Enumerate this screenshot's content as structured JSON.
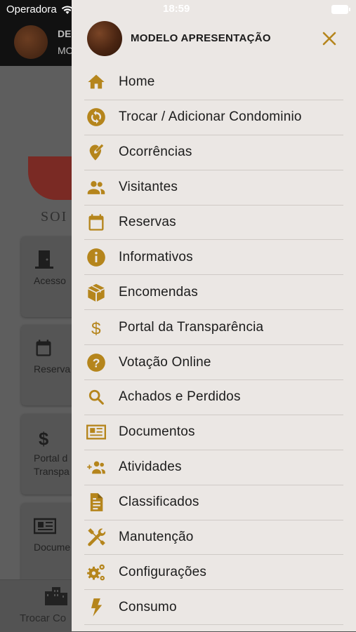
{
  "status_bar": {
    "carrier": "Operadora",
    "time": "18:59"
  },
  "background": {
    "header_line1": "DE",
    "header_line2": "MO",
    "logo_text": "SOI",
    "cards": [
      {
        "label": "Acesso",
        "icon": "door-icon"
      },
      {
        "label": "Reserva",
        "icon": "calendar-icon"
      },
      {
        "label": "Portal d\nTranspa",
        "icon": "dollar-icon"
      },
      {
        "label": "Docume",
        "icon": "newspaper-icon"
      }
    ],
    "tab_label": "Trocar Co"
  },
  "drawer": {
    "title": "MODELO APRESENTAÇÃO",
    "accent_color": "#b5851c",
    "items": [
      {
        "label": "Home",
        "icon": "home-icon"
      },
      {
        "label": "Trocar / Adicionar Condominio",
        "icon": "sync-icon"
      },
      {
        "label": "Ocorrências",
        "icon": "location-edit-icon"
      },
      {
        "label": "Visitantes",
        "icon": "people-icon"
      },
      {
        "label": "Reservas",
        "icon": "calendar-icon"
      },
      {
        "label": "Informativos",
        "icon": "info-icon"
      },
      {
        "label": "Encomendas",
        "icon": "package-icon"
      },
      {
        "label": "Portal da Transparência",
        "icon": "dollar-icon"
      },
      {
        "label": "Votação Online",
        "icon": "help-icon"
      },
      {
        "label": "Achados e Perdidos",
        "icon": "search-icon"
      },
      {
        "label": "Documentos",
        "icon": "newspaper-icon"
      },
      {
        "label": "Atividades",
        "icon": "group-add-icon"
      },
      {
        "label": "Classificados",
        "icon": "document-icon"
      },
      {
        "label": "Manutenção",
        "icon": "tools-icon"
      },
      {
        "label": "Configurações",
        "icon": "gears-icon"
      },
      {
        "label": "Consumo",
        "icon": "flash-icon"
      }
    ]
  }
}
